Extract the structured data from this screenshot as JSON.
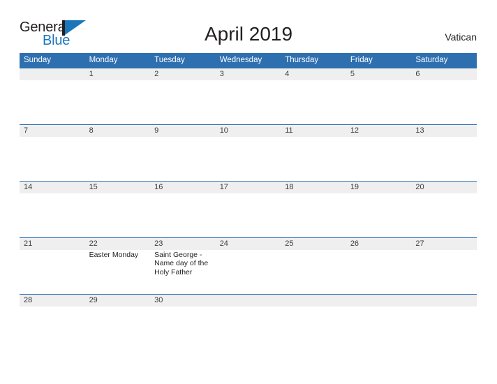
{
  "brand": {
    "word_one": "General",
    "word_two": "Blue",
    "flag_icon": "flag-triangle-icon",
    "accent_color": "#1b75bb",
    "text_color": "#231f20"
  },
  "header": {
    "title": "April 2019",
    "region": "Vatican"
  },
  "calendar": {
    "header_bg": "#2e6fb0",
    "header_text_color": "#ffffff",
    "strip_bg": "#efefef",
    "grid_line_color": "#2e6fb0",
    "day_names": [
      "Sunday",
      "Monday",
      "Tuesday",
      "Wednesday",
      "Thursday",
      "Friday",
      "Saturday"
    ],
    "weeks": [
      [
        {
          "date": "",
          "event": ""
        },
        {
          "date": "1",
          "event": ""
        },
        {
          "date": "2",
          "event": ""
        },
        {
          "date": "3",
          "event": ""
        },
        {
          "date": "4",
          "event": ""
        },
        {
          "date": "5",
          "event": ""
        },
        {
          "date": "6",
          "event": ""
        }
      ],
      [
        {
          "date": "7",
          "event": ""
        },
        {
          "date": "8",
          "event": ""
        },
        {
          "date": "9",
          "event": ""
        },
        {
          "date": "10",
          "event": ""
        },
        {
          "date": "11",
          "event": ""
        },
        {
          "date": "12",
          "event": ""
        },
        {
          "date": "13",
          "event": ""
        }
      ],
      [
        {
          "date": "14",
          "event": ""
        },
        {
          "date": "15",
          "event": ""
        },
        {
          "date": "16",
          "event": ""
        },
        {
          "date": "17",
          "event": ""
        },
        {
          "date": "18",
          "event": ""
        },
        {
          "date": "19",
          "event": ""
        },
        {
          "date": "20",
          "event": ""
        }
      ],
      [
        {
          "date": "21",
          "event": ""
        },
        {
          "date": "22",
          "event": "Easter Monday"
        },
        {
          "date": "23",
          "event": "Saint George - Name day of the Holy Father"
        },
        {
          "date": "24",
          "event": ""
        },
        {
          "date": "25",
          "event": ""
        },
        {
          "date": "26",
          "event": ""
        },
        {
          "date": "27",
          "event": ""
        }
      ],
      [
        {
          "date": "28",
          "event": ""
        },
        {
          "date": "29",
          "event": ""
        },
        {
          "date": "30",
          "event": ""
        },
        {
          "date": "",
          "event": ""
        },
        {
          "date": "",
          "event": ""
        },
        {
          "date": "",
          "event": ""
        },
        {
          "date": "",
          "event": ""
        }
      ]
    ]
  }
}
